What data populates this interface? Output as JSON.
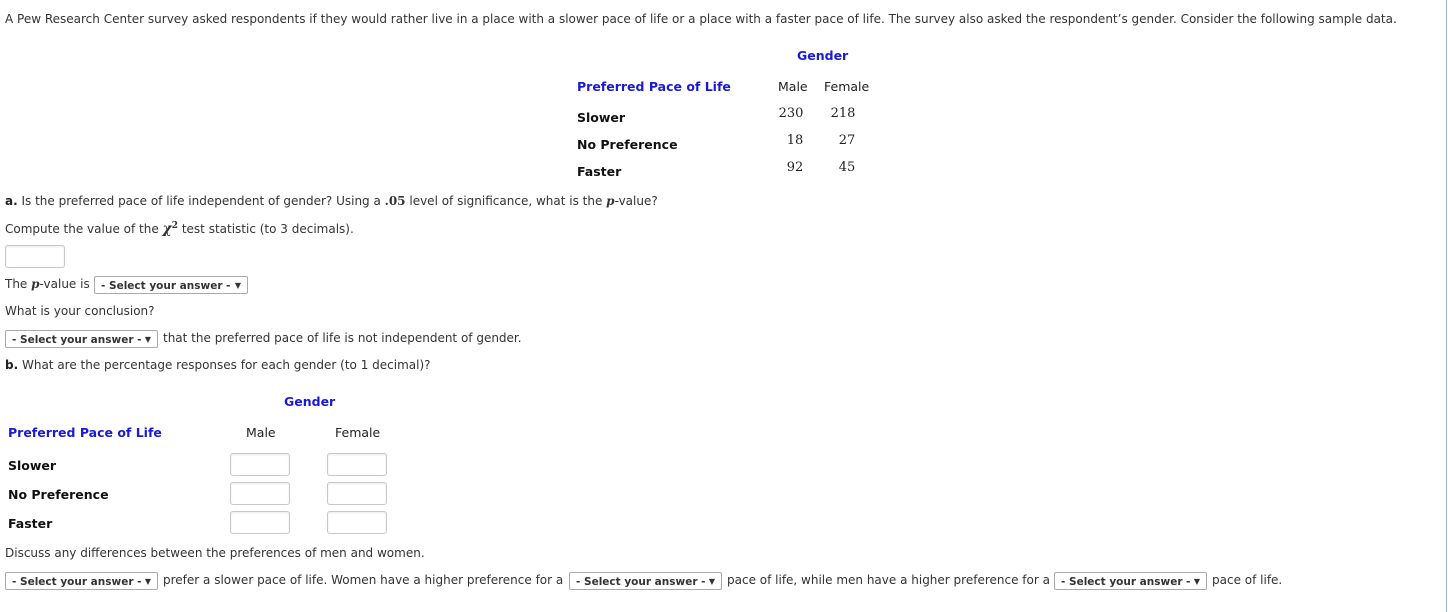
{
  "intro": "A Pew Research Center survey asked respondents if they would rather live in a place with a slower pace of life or a place with a faster pace of life. The survey also asked the respondent’s gender. Consider the following sample data.",
  "data_table": {
    "group_header": "Gender",
    "row_header": "Preferred Pace of Life",
    "columns": [
      "Male",
      "Female"
    ],
    "rows": [
      {
        "label": "Slower",
        "values": [
          "230",
          "218"
        ]
      },
      {
        "label": "No Preference",
        "values": [
          "18",
          "27"
        ]
      },
      {
        "label": "Faster",
        "values": [
          "92",
          "45"
        ]
      }
    ]
  },
  "part_a": {
    "prefix": "a.",
    "question_1": " Is the preferred pace of life independent of gender? Using a ",
    "alpha": ".05",
    "question_2": " level of significance, what is the ",
    "p_letter": "p",
    "question_3": "-value?",
    "compute_1": "Compute the value of the ",
    "chi": "χ",
    "chi_sup": "2",
    "compute_2": " test statistic (to 3 decimals).",
    "chi_value": "",
    "pvalue_label_1": "The ",
    "pvalue_label_2": "-value is",
    "pvalue_select": "- Select your answer -",
    "conclusion_q": "What is your conclusion?",
    "conclusion_select": "- Select your answer -",
    "conclusion_text": "that the preferred pace of life is not independent of gender."
  },
  "part_b": {
    "prefix": "b.",
    "question": " What are the percentage responses for each gender (to 1 decimal)?",
    "group_header": "Gender",
    "row_header": "Preferred Pace of Life",
    "columns": [
      "Male",
      "Female"
    ],
    "rows": [
      {
        "label": "Slower",
        "values": [
          "",
          ""
        ]
      },
      {
        "label": "No Preference",
        "values": [
          "",
          ""
        ]
      },
      {
        "label": "Faster",
        "values": [
          "",
          ""
        ]
      }
    ]
  },
  "discuss": {
    "prompt": "Discuss any differences between the preferences of men and women.",
    "select_1": "- Select your answer -",
    "text_1": "prefer a slower pace of life. Women have a higher preference for a",
    "select_2": "- Select your answer -",
    "text_2": "pace of life, while men have a higher preference for a",
    "select_3": "- Select your answer -",
    "text_3": "pace of life."
  },
  "icons": {
    "dropdown": "▼"
  }
}
